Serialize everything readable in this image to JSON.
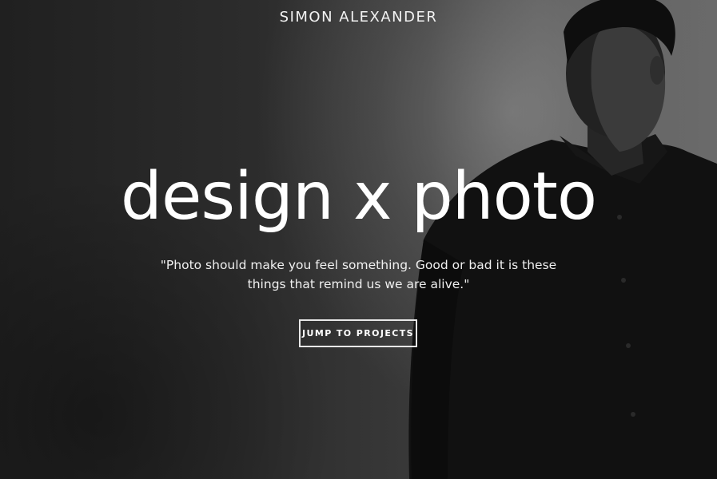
{
  "brand": {
    "name": "SIMON ALEXANDER"
  },
  "hero": {
    "headline": "design x photo",
    "quote_line_1": "\"Photo should make you feel something. Good or bad it is these",
    "quote_line_2": "things that remind us we are alive.\"",
    "cta_label": "JUMP TO PROJECTS"
  },
  "image": {
    "subject": "black-and-white portrait of a man in a dark shirt",
    "icon": "person-portrait"
  },
  "colors": {
    "text": "#ffffff",
    "background_dark": "#1a1a1a",
    "background_light": "#6a6a6a"
  }
}
